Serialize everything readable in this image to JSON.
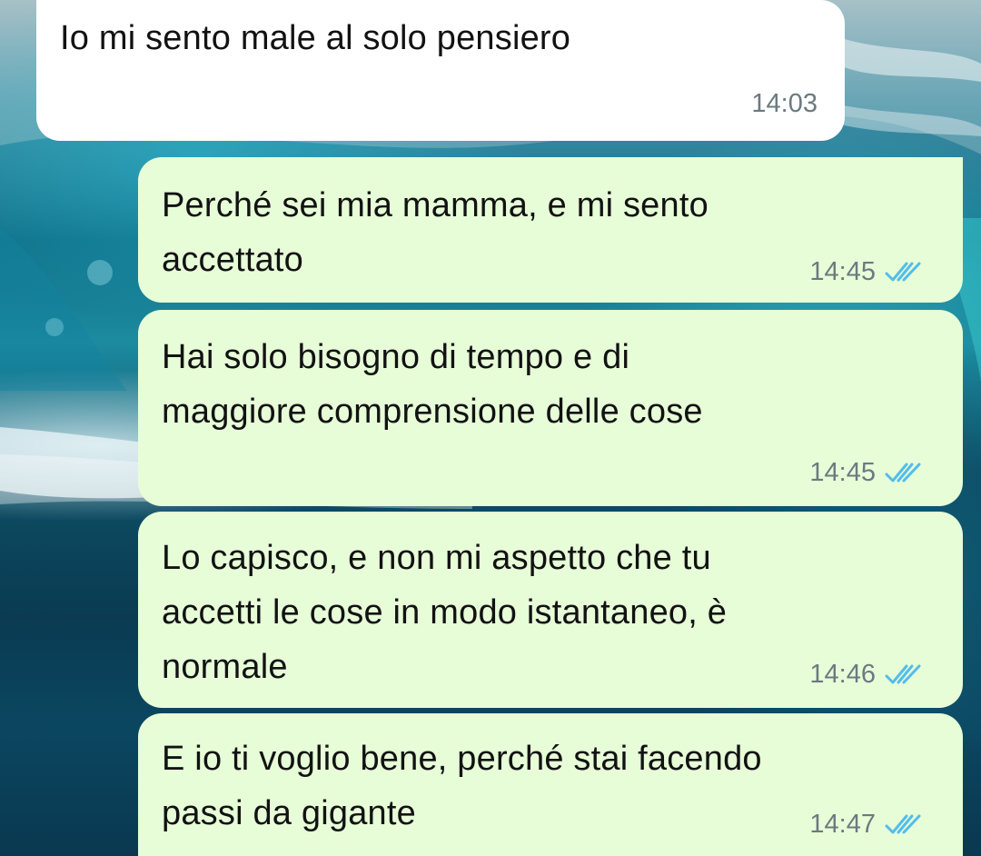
{
  "messages": [
    {
      "direction": "incoming",
      "text": "Io mi sento male al solo pensiero",
      "time": "14:03"
    },
    {
      "direction": "outgoing",
      "text": "Perché sei mia mamma, e mi sento\naccettato",
      "time": "14:45",
      "status": "read"
    },
    {
      "direction": "outgoing",
      "text": "Hai solo bisogno di tempo e di\nmaggiore comprensione delle cose",
      "time": "14:45",
      "status": "read"
    },
    {
      "direction": "outgoing",
      "text": "Lo capisco, e non mi aspetto che tu\naccetti le cose in modo istantaneo, è\nnormale",
      "time": "14:46",
      "status": "read"
    },
    {
      "direction": "outgoing",
      "text": "E io ti voglio bene, perché stai facendo\npassi da gigante",
      "time": "14:47",
      "status": "read"
    }
  ],
  "colors": {
    "incoming_bubble": "#ffffff",
    "outgoing_bubble": "#e7fdd8",
    "read_ticks": "#53bdeb",
    "time_text": "#6b7a80"
  },
  "icons": {
    "read_status": "double-check-icon"
  }
}
